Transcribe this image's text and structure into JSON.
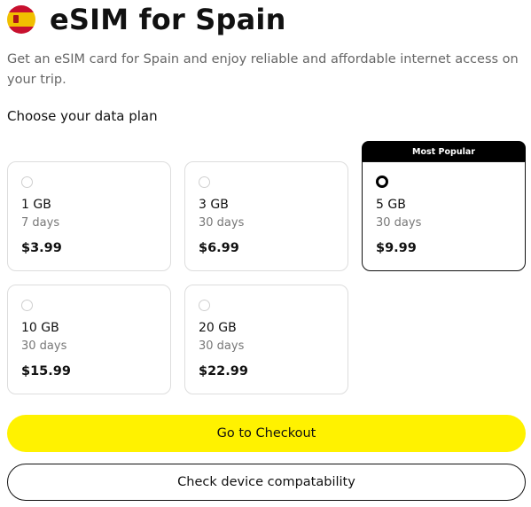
{
  "header": {
    "flag_icon": "spain-flag-icon",
    "title": "eSIM for Spain"
  },
  "description": "Get an eSIM card for Spain and enjoy reliable and affordable internet access on your trip.",
  "section_label": "Choose your data plan",
  "popular_tag": "Most Popular",
  "plans": [
    {
      "data": "1 GB",
      "duration": "7 days",
      "price": "$3.99",
      "selected": false
    },
    {
      "data": "3 GB",
      "duration": "30 days",
      "price": "$6.99",
      "selected": false
    },
    {
      "data": "5 GB",
      "duration": "30 days",
      "price": "$9.99",
      "selected": true
    },
    {
      "data": "10 GB",
      "duration": "30 days",
      "price": "$15.99",
      "selected": false
    },
    {
      "data": "20 GB",
      "duration": "30 days",
      "price": "$22.99",
      "selected": false
    }
  ],
  "buttons": {
    "checkout": "Go to Checkout",
    "compatibility": "Check device compatability"
  },
  "colors": {
    "accent": "#fff200",
    "selected_border": "#111111",
    "tag_background": "#000000"
  }
}
